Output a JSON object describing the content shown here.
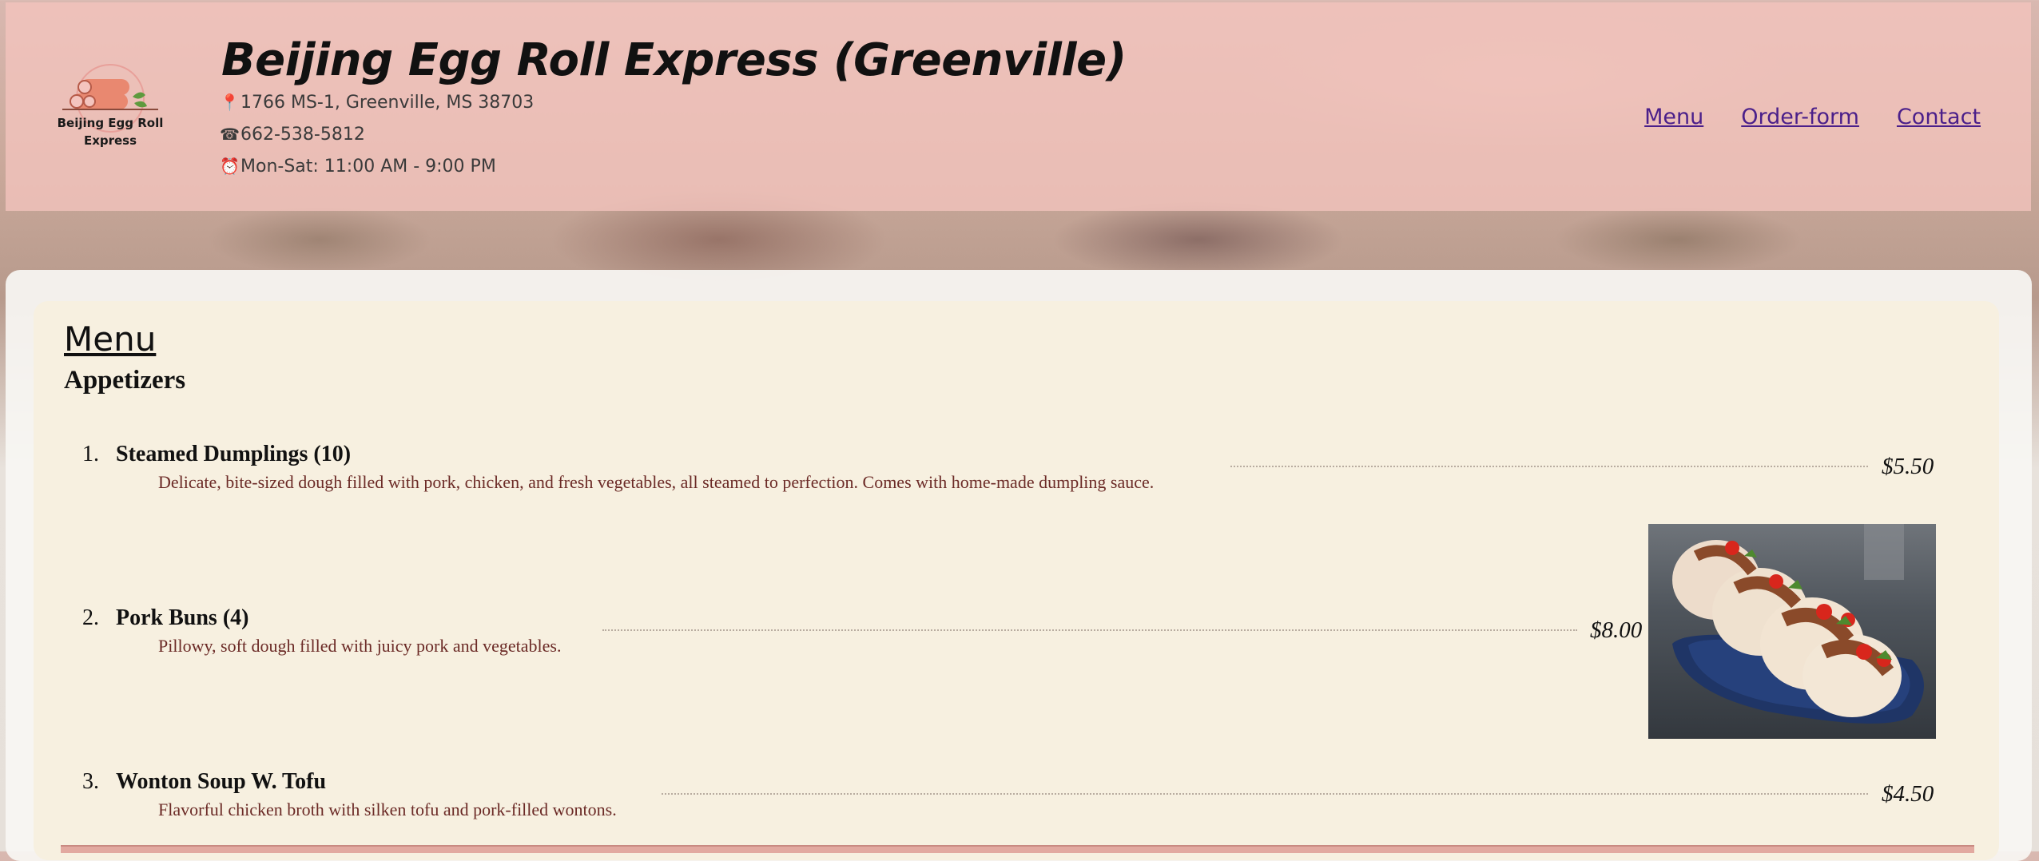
{
  "header": {
    "title": "Beijing Egg Roll Express (Greenville)",
    "logo_text_line1": "Beijing Egg Roll",
    "logo_text_line2": "Express",
    "address_icon": "location-icon",
    "address": "1766 MS-1, Greenville, MS 38703",
    "phone_icon": "phone-icon",
    "phone": "662-538-5812",
    "hours_icon": "clock-icon",
    "hours": "Mon-Sat: 11:00 AM - 9:00 PM"
  },
  "nav": {
    "items": [
      "Menu",
      "Order-form",
      "Contact"
    ]
  },
  "menu": {
    "heading": "Menu",
    "section": "Appetizers",
    "items": [
      {
        "number": "1.",
        "name": "Steamed Dumplings (10)",
        "description": "Delicate, bite-sized dough filled with pork, chicken, and fresh vegetables, all steamed to perfection. Comes with home-made dumpling sauce.",
        "price": "$5.50"
      },
      {
        "number": "2.",
        "name": "Pork Buns (4)",
        "description": "Pillowy, soft dough filled with juicy pork and vegetables.",
        "price": "$8.00"
      },
      {
        "number": "3.",
        "name": "Wonton Soup W. Tofu",
        "description": "Flavorful chicken broth with silken tofu and pork-filled wontons.",
        "price": "$4.50"
      }
    ]
  },
  "colors": {
    "header_bg": "#f4c4be",
    "panel_bg": "#f7f0e0",
    "nav_link": "#4a1f8a",
    "description": "#6b2a26"
  }
}
